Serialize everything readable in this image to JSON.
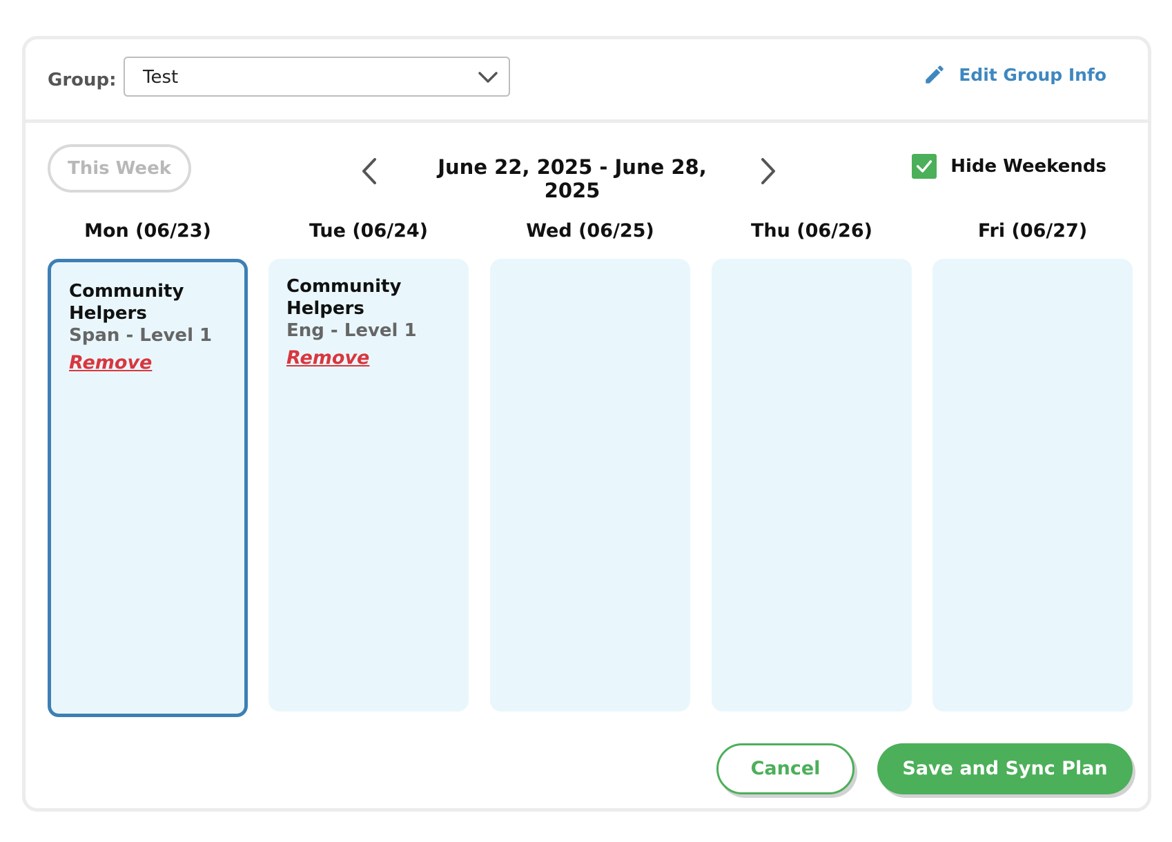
{
  "header": {
    "group_label": "Group:",
    "group_value": "Test",
    "edit_label": "Edit Group Info"
  },
  "week_nav": {
    "this_week_label": "This Week",
    "date_range": "June 22, 2025 - June 28, 2025",
    "hide_weekends_label": "Hide Weekends",
    "hide_weekends_checked": true
  },
  "days": [
    {
      "header": "Mon (06/23)",
      "selected": true,
      "lesson": {
        "title": "Community Helpers",
        "subtitle": "Span - Level 1",
        "remove_label": "Remove"
      }
    },
    {
      "header": "Tue (06/24)",
      "selected": false,
      "lesson": {
        "title": "Community Helpers",
        "subtitle": "Eng - Level 1",
        "remove_label": "Remove"
      }
    },
    {
      "header": "Wed (06/25)",
      "selected": false
    },
    {
      "header": "Thu (06/26)",
      "selected": false
    },
    {
      "header": "Fri (06/27)",
      "selected": false
    }
  ],
  "actions": {
    "cancel_label": "Cancel",
    "save_label": "Save and Sync Plan"
  },
  "colors": {
    "accent_green": "#4caf59",
    "link_blue": "#3f87bf",
    "selected_border": "#3d7fb4",
    "day_bg": "#e9f7fc",
    "remove_red": "#d9363e"
  },
  "icons": {
    "edit": "pencil-icon",
    "select": "chevron-down-icon",
    "prev": "chevron-left-icon",
    "next": "chevron-right-icon",
    "checkbox": "check-icon"
  }
}
